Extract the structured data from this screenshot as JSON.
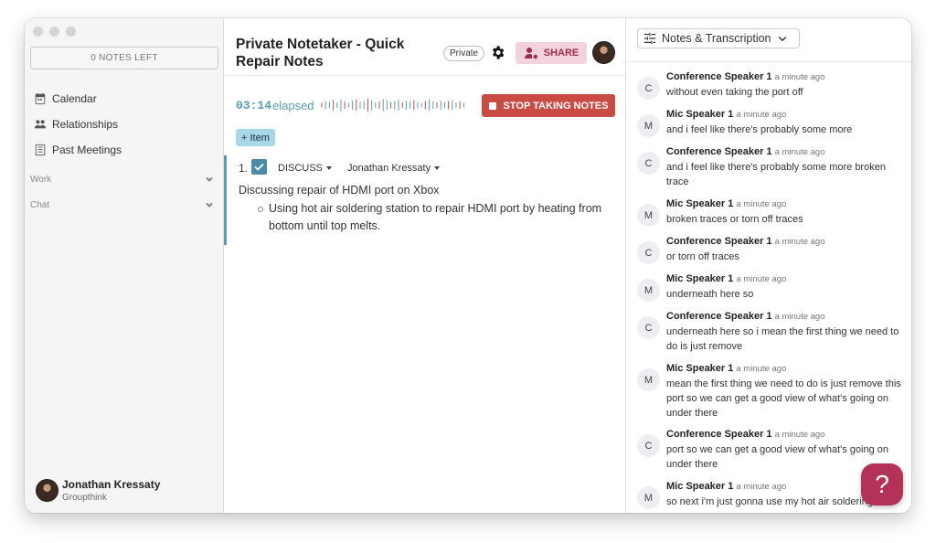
{
  "sidebar": {
    "notes_left": "0 NOTES LEFT",
    "nav": [
      {
        "label": "Calendar",
        "icon": "calendar-icon"
      },
      {
        "label": "Relationships",
        "icon": "people-icon"
      },
      {
        "label": "Past Meetings",
        "icon": "list-icon"
      }
    ],
    "groups": [
      {
        "label": "Work"
      },
      {
        "label": "Chat"
      }
    ],
    "user": {
      "name": "Jonathan Kressaty",
      "org": "Groupthink"
    }
  },
  "main": {
    "title": "Private Notetaker - Quick Repair Notes",
    "privacy_badge": "Private",
    "share_label": "SHARE",
    "timer": "03:14",
    "elapsed_label": "elapsed",
    "stop_label": "STOP TAKING NOTES",
    "add_item_label": "+ Item",
    "agenda": {
      "number": "1.",
      "type": "DISCUSS",
      "assignee": "Jonathan Kressaty",
      "description": "Discussing repair of HDMI port on Xbox",
      "bullet": "Using hot air soldering station to repair HDMI port by heating from bottom until top melts."
    }
  },
  "right": {
    "dropdown_label": "Notes & Transcription",
    "transcript": [
      {
        "initial": "C",
        "speaker": "Conference Speaker 1",
        "time": "a minute ago",
        "text": "without even taking the port off"
      },
      {
        "initial": "M",
        "speaker": "Mic Speaker 1",
        "time": "a minute ago",
        "text": "and i feel like there's probably some more"
      },
      {
        "initial": "C",
        "speaker": "Conference Speaker 1",
        "time": "a minute ago",
        "text": "and i feel like there's probably some more broken trace"
      },
      {
        "initial": "M",
        "speaker": "Mic Speaker 1",
        "time": "a minute ago",
        "text": "broken traces or torn off traces"
      },
      {
        "initial": "C",
        "speaker": "Conference Speaker 1",
        "time": "a minute ago",
        "text": "or torn off traces"
      },
      {
        "initial": "M",
        "speaker": "Mic Speaker 1",
        "time": "a minute ago",
        "text": "underneath here so"
      },
      {
        "initial": "C",
        "speaker": "Conference Speaker 1",
        "time": "a minute ago",
        "text": "underneath here so i mean the first thing we need to do is just remove"
      },
      {
        "initial": "M",
        "speaker": "Mic Speaker 1",
        "time": "a minute ago",
        "text": "mean the first thing we need to do is just remove this port so we can get a good view of what's going on under there"
      },
      {
        "initial": "C",
        "speaker": "Conference Speaker 1",
        "time": "a minute ago",
        "text": "port so we can get a good view of what's going on under there"
      },
      {
        "initial": "M",
        "speaker": "Mic Speaker 1",
        "time": "a minute ago",
        "text": "so next i'm just gonna use my hot air soldering"
      }
    ]
  },
  "help_label": "?",
  "colors": {
    "accent": "#5a9db2",
    "stop": "#c94b44",
    "share_bg": "#f2d2dc",
    "share_text": "#9c2c47",
    "help": "#b23258"
  }
}
